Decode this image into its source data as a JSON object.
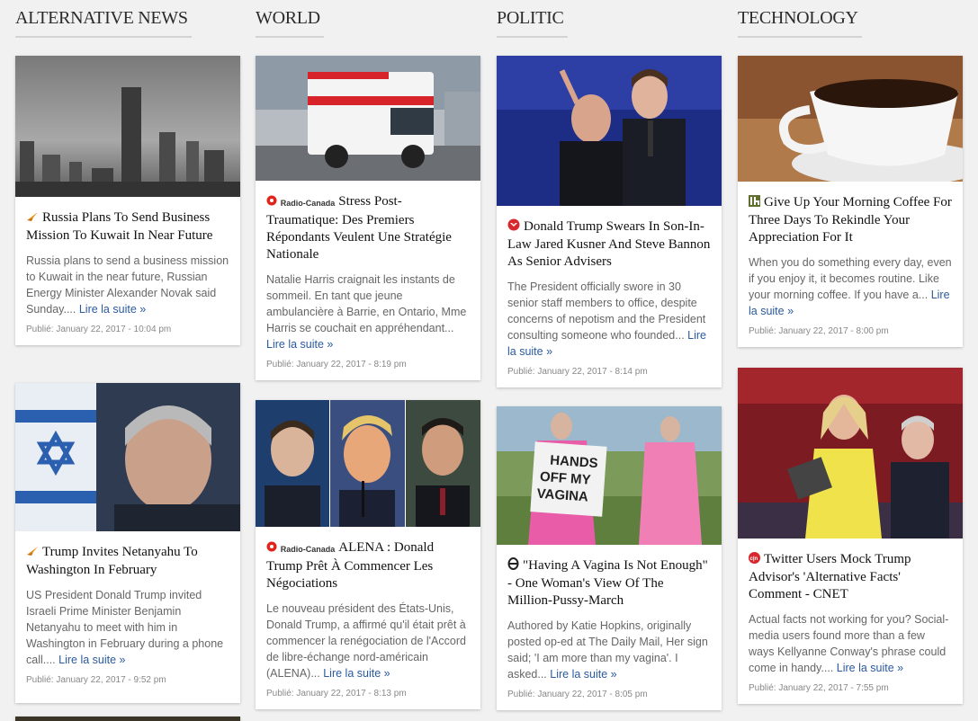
{
  "columns": [
    {
      "title": "ALTERNATIVE NEWS",
      "cards": [
        {
          "headline": "Russia Plans To Send Business Mission To Kuwait In Near Future",
          "source_icon": "rt-bird-icon",
          "excerpt": "Russia plans to send a business mission to Kuwait in the near future, Russian Energy Minister Alexander Novak said Sunday....",
          "more": "Lire la suite »",
          "date": "Publié: January 22, 2017 - 10:04 pm"
        },
        {
          "headline": "Trump Invites Netanyahu To Washington In February",
          "source_icon": "rt-bird-icon",
          "excerpt": "US President Donald Trump invited Israeli Prime Minister Benjamin Netanyahu to meet with him in Washington in February during a phone call....",
          "more": "Lire la suite »",
          "date": "Publié: January 22, 2017 - 9:52 pm"
        }
      ]
    },
    {
      "title": "WORLD",
      "cards": [
        {
          "headline": "Stress Post-Traumatique: Des Premiers Répondants Veulent Une Stratégie Nationale",
          "source_label": "Radio-Canada",
          "source_icon": "radio-canada-logo-icon",
          "excerpt": "Natalie Harris craignait les instants de sommeil. En tant que jeune ambulancière à Barrie, en Ontario, Mme Harris se couchait en appréhendant...",
          "more": "Lire la suite »",
          "date": "Publié: January 22, 2017 - 8:19 pm"
        },
        {
          "headline": "ALENA : Donald Trump Prêt À Commencer Les Négociations",
          "source_label": "Radio-Canada",
          "source_icon": "radio-canada-logo-icon",
          "excerpt": "Le nouveau président des États-Unis, Donald Trump, a affirmé qu'il était prêt à commencer la renégociation de l'Accord de libre-échange nord-américain (ALENA)...",
          "more": "Lire la suite »",
          "date": "Publié: January 22, 2017 - 8:13 pm"
        }
      ]
    },
    {
      "title": "POLITIC",
      "cards": [
        {
          "headline": "Donald Trump Swears In Son-In-Law Jared Kusner And Steve Bannon As Senior Advisers",
          "source_icon": "red-eagle-icon",
          "excerpt": "The President officially swore in 30 senior staff members to office, despite concerns of nepotism and the President consulting someone who founded...",
          "more": "Lire la suite »",
          "date": "Publié: January 22, 2017 - 8:14 pm"
        },
        {
          "headline": "\"Having A Vagina Is Not Enough\" - One Woman's View Of The Million-Pussy-March",
          "source_icon": "theta-circle-icon",
          "excerpt": "Authored by Katie Hopkins, originally posted op-ed at The Daily Mail, Her sign said; 'I am more than my vagina'. I asked...",
          "more": "Lire la suite »",
          "date": "Publié: January 22, 2017 - 8:05 pm",
          "sign_text": "HANDS OFF MY VAGINA"
        }
      ]
    },
    {
      "title": "TECHNOLOGY",
      "cards": [
        {
          "headline": "Give Up Your Morning Coffee For Three Days To Rekindle Your Appreciation For It",
          "source_icon": "lifehacker-icon",
          "excerpt": "When you do something every day, even if you enjoy it, it becomes routine. Like your morning coffee. If you have a...",
          "more": "Lire la suite »",
          "date": "Publié: January 22, 2017 - 8:00 pm"
        },
        {
          "headline": "Twitter Users Mock Trump Advisor's 'Alternative Facts' Comment - CNET",
          "source_icon": "cnet-icon",
          "excerpt": "Actual facts not working for you? Social-media users found more than a few ways Kellyanne Conway's phrase could come in handy....",
          "more": "Lire la suite »",
          "date": "Publié: January 22, 2017 - 7:55 pm"
        }
      ]
    }
  ],
  "colors": {
    "link": "#2a5a9e",
    "title": "#2b2b2b",
    "excerpt": "#666666",
    "date": "#888888",
    "background": "#f1f1f1"
  }
}
